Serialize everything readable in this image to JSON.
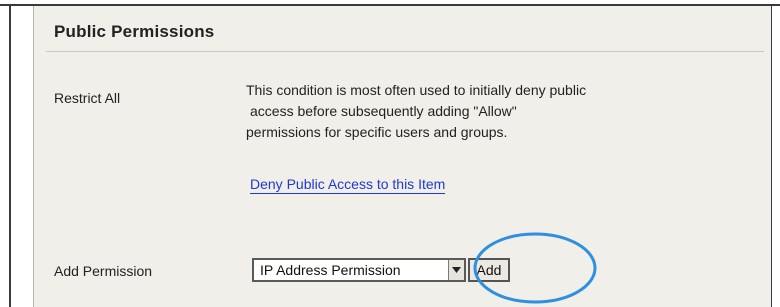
{
  "section": {
    "title": "Public Permissions"
  },
  "restrict_all": {
    "label": "Restrict All",
    "description_lines": [
      "This condition is most often used to initially deny public",
      "access before subsequently adding \"Allow\"",
      "permissions for specific users and groups."
    ],
    "link_text": "Deny Public Access to this Item"
  },
  "add_permission": {
    "label": "Add Permission",
    "selected_option": "IP Address Permission",
    "button_label": "Add"
  },
  "colors": {
    "link": "#1f3ad1",
    "panel_background": "#f0efea",
    "highlight_ring": "#2f8fe0"
  },
  "icons": {
    "dropdown": "chevron-down-icon"
  }
}
